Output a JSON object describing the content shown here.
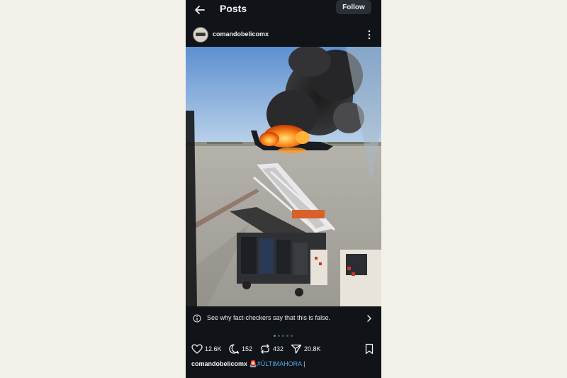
{
  "header": {
    "title": "Posts",
    "follow_label": "Follow"
  },
  "post": {
    "author": "comandobelicomx",
    "fact_check": "See why fact-checkers say that this is false.",
    "carousel": {
      "count": 5,
      "active": 1
    },
    "stats": {
      "likes": "12.6K",
      "comments": "152",
      "reposts": "432",
      "shares": "20.8K"
    },
    "caption": {
      "handle": "comandobelicomx",
      "emoji": "🚨",
      "hashtag": "#ÚLTIMAHORA",
      "cursor": "|"
    }
  },
  "icons": [
    "back-arrow-icon",
    "more-options-icon",
    "info-icon",
    "chevron-right-icon",
    "heart-icon",
    "comment-icon",
    "repost-icon",
    "share-icon",
    "bookmark-icon"
  ]
}
